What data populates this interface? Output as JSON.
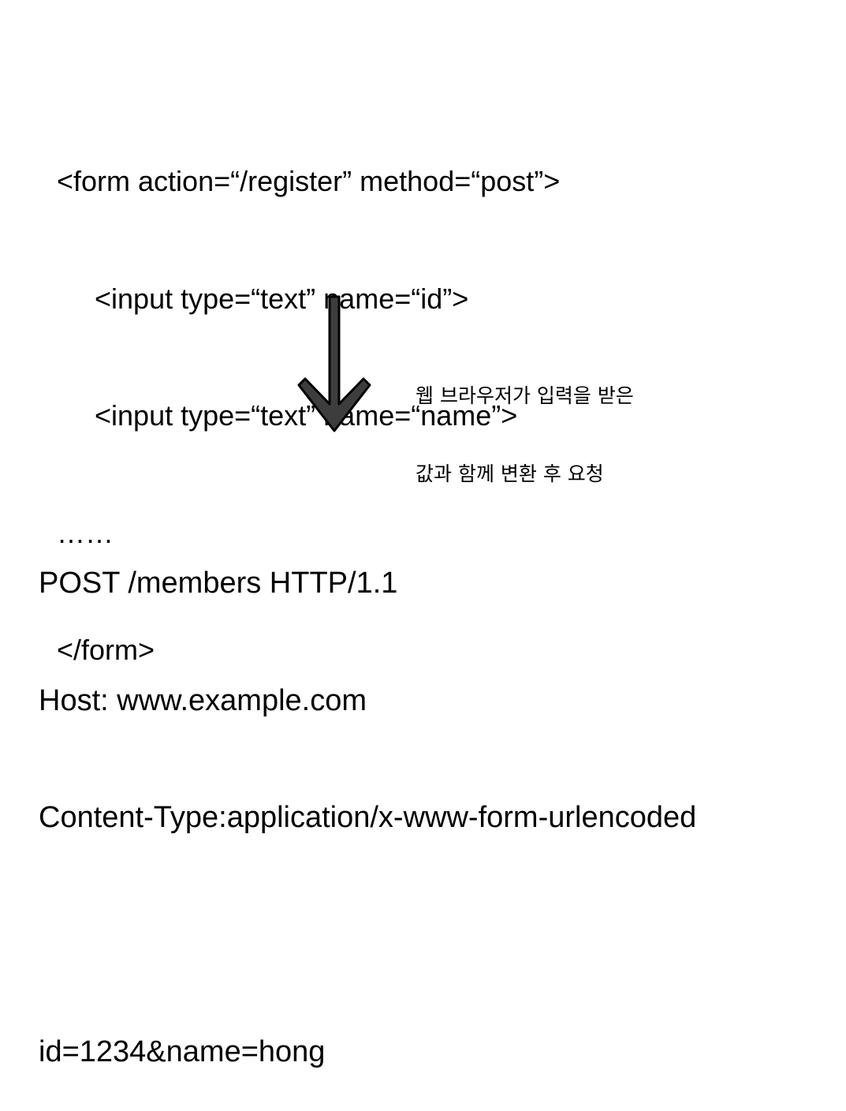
{
  "form_code": {
    "lines": [
      "<form action=“/register” method=“post”>",
      "<input type=“text” name=“id”>",
      "<input type=“text” name=“name”>",
      "……",
      "</form>"
    ]
  },
  "arrow": {
    "icon": "down-arrow-icon",
    "fill_color": "#3d3d3d",
    "stroke_color": "#000000"
  },
  "note": {
    "lines": [
      "웹 브라우저가 입력을 받은",
      "값과 함께 변환 후 요청"
    ]
  },
  "http_request": {
    "lines": [
      "POST /members HTTP/1.1",
      "Host: www.example.com",
      "Content-Type:application/x-www-form-urlencoded",
      "",
      "id=1234&name=hong"
    ]
  }
}
